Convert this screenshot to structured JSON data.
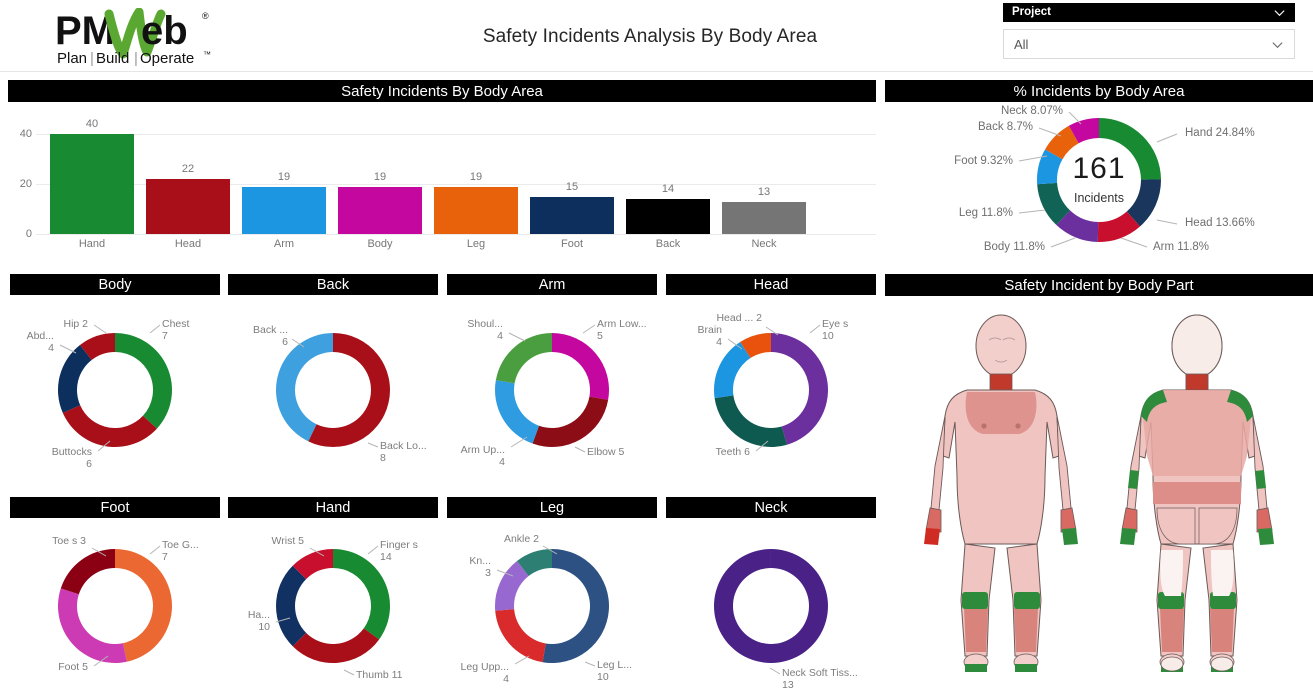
{
  "header": {
    "logo_text": "PMWeb",
    "logo_tagline": "Plan|Build|Operate",
    "logo_trademark": "®",
    "title": "Safety Incidents Analysis By Body Area"
  },
  "slicer": {
    "label": "Project",
    "value": "All",
    "chevron_icon": "chevron-down-icon"
  },
  "panels": {
    "bar": "Safety Incidents By Body Area",
    "pct": "% Incidents by Body Area",
    "body": "Body",
    "back": "Back",
    "arm": "Arm",
    "head": "Head",
    "foot": "Foot",
    "hand": "Hand",
    "leg": "Leg",
    "neck": "Neck",
    "bodypart": "Safety Incident by Body Part"
  },
  "chart_data": [
    {
      "id": "bar_incidents_by_body_area",
      "type": "bar",
      "title": "Safety Incidents By Body Area",
      "xlabel": "",
      "ylabel": "",
      "ylim": [
        0,
        44
      ],
      "yticks": [
        0,
        20,
        40
      ],
      "grid": true,
      "categories": [
        "Hand",
        "Head",
        "Arm",
        "Body",
        "Leg",
        "Foot",
        "Back",
        "Neck"
      ],
      "values": [
        40,
        22,
        19,
        19,
        19,
        15,
        14,
        13
      ],
      "colors": [
        "#188a32",
        "#a80f18",
        "#1c96e0",
        "#c4079e",
        "#e8620c",
        "#0d2f5e",
        "#000000",
        "#757575"
      ]
    },
    {
      "id": "donut_pct_incidents_by_body_area",
      "type": "pie",
      "title": "% Incidents by Body Area",
      "center_value": "161",
      "center_label": "Incidents",
      "total": 161,
      "legend": "callout-labels",
      "categories": [
        "Hand",
        "Head",
        "Arm",
        "Body",
        "Leg",
        "Foot",
        "Back",
        "Neck"
      ],
      "values": [
        24.84,
        13.66,
        11.8,
        11.8,
        11.8,
        9.32,
        8.7,
        8.07
      ],
      "labels": [
        "Hand 24.84%",
        "Head 13.66%",
        "Arm 11.8%",
        "Body 11.8%",
        "Leg 11.8%",
        "Foot 9.32%",
        "Back 8.7%",
        "Neck 8.07%"
      ],
      "colors": [
        "#188a32",
        "#1b365d",
        "#c8102e",
        "#6b2f9e",
        "#116355",
        "#1c96e0",
        "#e8620c",
        "#c4079e"
      ]
    },
    {
      "id": "donut_body",
      "type": "pie",
      "title": "Body",
      "categories": [
        "Chest",
        "Buttocks",
        "Abd...",
        "Hip"
      ],
      "values": [
        7,
        6,
        4,
        2
      ],
      "labels": [
        "Chest",
        "Buttocks",
        "Abd...",
        "Hip 2"
      ],
      "value_labels": [
        "7",
        "6",
        "4",
        ""
      ],
      "colors": [
        "#188a32",
        "#a80f18",
        "#0d2f5e",
        "#a80f18"
      ]
    },
    {
      "id": "donut_back",
      "type": "pie",
      "title": "Back",
      "categories": [
        "Back Lo...",
        "Back ..."
      ],
      "values": [
        8,
        6
      ],
      "labels": [
        "Back Lo...",
        "Back ..."
      ],
      "value_labels": [
        "8",
        "6"
      ],
      "colors": [
        "#a80f18",
        "#3fa0e0"
      ]
    },
    {
      "id": "donut_arm",
      "type": "pie",
      "title": "Arm",
      "categories": [
        "Arm Low...",
        "Elbow",
        "Arm Up...",
        "Shoul..."
      ],
      "values": [
        5,
        5,
        4,
        4
      ],
      "labels": [
        "Arm Low...",
        "Elbow 5",
        "Arm Up...",
        "Shoul..."
      ],
      "value_labels": [
        "5",
        "",
        "4",
        "4"
      ],
      "colors": [
        "#c4079e",
        "#8c0d16",
        "#2f9be0",
        "#4a9e3f"
      ]
    },
    {
      "id": "donut_head",
      "type": "pie",
      "title": "Head",
      "categories": [
        "Eye s",
        "Teeth",
        "Brain",
        "Head ..."
      ],
      "values": [
        10,
        6,
        4,
        2
      ],
      "labels": [
        "Eye s",
        "Teeth 6",
        "Brain",
        "Head ... 2"
      ],
      "value_labels": [
        "10",
        "",
        "4",
        ""
      ],
      "colors": [
        "#6b2f9e",
        "#0f5a50",
        "#1c96e0",
        "#e8520c"
      ]
    },
    {
      "id": "donut_foot",
      "type": "pie",
      "title": "Foot",
      "categories": [
        "Toe G...",
        "Foot",
        "Toe s"
      ],
      "values": [
        7,
        5,
        3
      ],
      "labels": [
        "Toe G...",
        "Foot 5",
        "Toe s 3"
      ],
      "value_labels": [
        "7",
        "",
        ""
      ],
      "colors": [
        "#ec6833",
        "#cc3bb4",
        "#8c0014"
      ]
    },
    {
      "id": "donut_hand",
      "type": "pie",
      "title": "Hand",
      "categories": [
        "Finger s",
        "Thumb",
        "Ha...",
        "Wrist"
      ],
      "values": [
        14,
        11,
        10,
        5
      ],
      "labels": [
        "Finger s",
        "Thumb 11",
        "Ha...",
        "Wrist 5"
      ],
      "value_labels": [
        "14",
        "",
        "10",
        ""
      ],
      "colors": [
        "#188a32",
        "#a80f18",
        "#123163",
        "#c8102e"
      ]
    },
    {
      "id": "donut_leg",
      "type": "pie",
      "title": "Leg",
      "categories": [
        "Leg L...",
        "Leg Upp...",
        "Kn...",
        "Ankle"
      ],
      "values": [
        10,
        4,
        3,
        2
      ],
      "labels": [
        "Leg L...",
        "Leg Upp...",
        "Kn...",
        "Ankle 2"
      ],
      "value_labels": [
        "10",
        "4",
        "3",
        ""
      ],
      "colors": [
        "#2d5182",
        "#d92b2b",
        "#9768cf",
        "#2e7f73"
      ]
    },
    {
      "id": "donut_neck",
      "type": "pie",
      "title": "Neck",
      "categories": [
        "Neck Soft Tiss..."
      ],
      "values": [
        13
      ],
      "labels": [
        "Neck Soft Tiss..."
      ],
      "value_labels": [
        "13"
      ],
      "colors": [
        "#4a2287"
      ]
    }
  ],
  "bodypart": {
    "front_view": "human-body-front-diagram",
    "back_view": "human-body-back-diagram"
  }
}
